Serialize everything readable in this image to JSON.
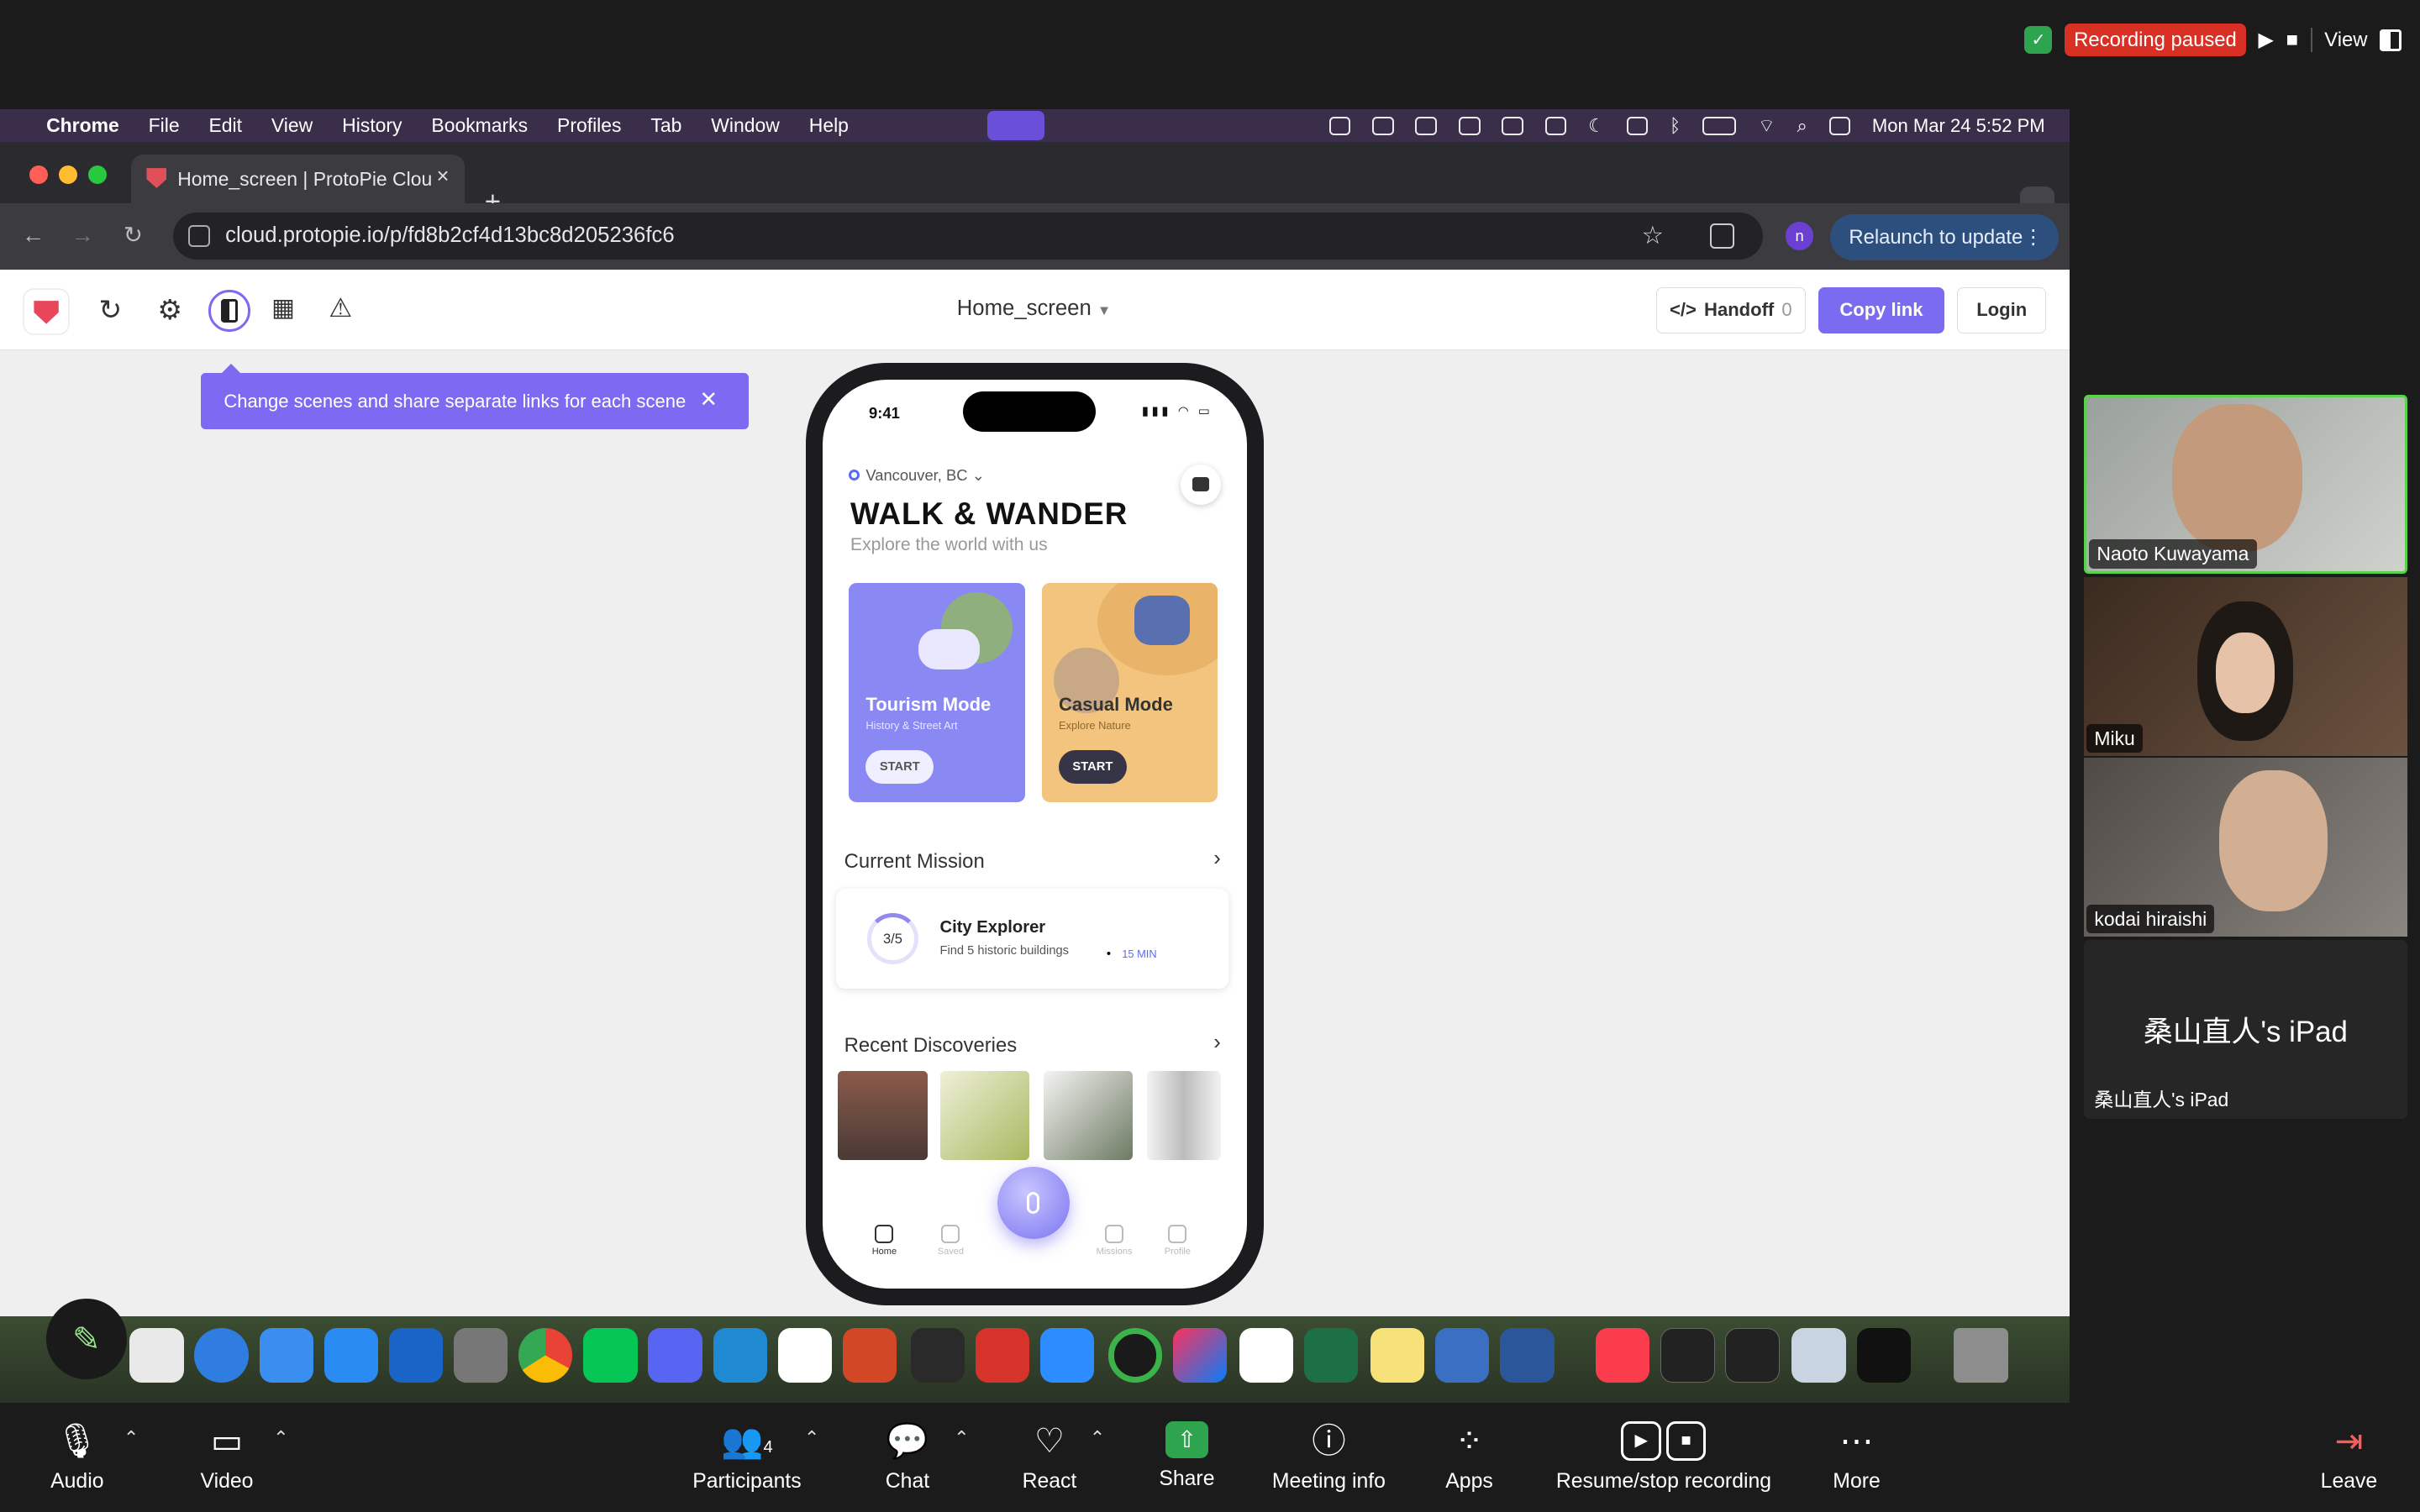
{
  "zoom_top": {
    "recording_status": "Recording paused",
    "view_label": "View"
  },
  "menubar": {
    "app": "Chrome",
    "items": [
      "File",
      "Edit",
      "View",
      "History",
      "Bookmarks",
      "Profiles",
      "Tab",
      "Window",
      "Help"
    ],
    "datetime": "Mon Mar 24  5:52 PM"
  },
  "browser": {
    "tab_title": "Home_screen | ProtoPie Clou",
    "url": "cloud.protopie.io/p/fd8b2cf4d13bc8d205236fc6",
    "profile_initial": "n",
    "relaunch_label": "Relaunch to update"
  },
  "protopie": {
    "scene_name": "Home_screen",
    "handoff_label": "Handoff",
    "handoff_count": "0",
    "copy_link_label": "Copy link",
    "login_label": "Login",
    "tooltip": "Change scenes and share separate links for each scene"
  },
  "phone": {
    "time": "9:41",
    "location": "Vancouver, BC",
    "title": "WALK & WANDER",
    "subtitle": "Explore the world with us",
    "cards": [
      {
        "title": "Tourism Mode",
        "subtitle": "History & Street Art",
        "button": "START"
      },
      {
        "title": "Casual Mode",
        "subtitle": "Explore Nature",
        "button": "START"
      }
    ],
    "current_mission_label": "Current Mission",
    "mission": {
      "progress": "3/5",
      "title": "City Explorer",
      "desc": "Find 5 historic buildings",
      "time": "15 MIN"
    },
    "recent_label": "Recent Discoveries",
    "nav": [
      "Home",
      "Saved",
      "Missions",
      "Profile"
    ]
  },
  "participants": [
    {
      "name": "Naoto Kuwayama"
    },
    {
      "name": "Miku"
    },
    {
      "name": "kodai hiraishi"
    },
    {
      "name": "桑山直人's iPad",
      "display": "桑山直人's iPad"
    }
  ],
  "zoom_bottom": {
    "audio": "Audio",
    "video": "Video",
    "participants": "Participants",
    "participant_count": "4",
    "chat": "Chat",
    "react": "React",
    "share": "Share",
    "meeting_info": "Meeting info",
    "apps": "Apps",
    "recording": "Resume/stop recording",
    "more": "More",
    "leave": "Leave"
  }
}
